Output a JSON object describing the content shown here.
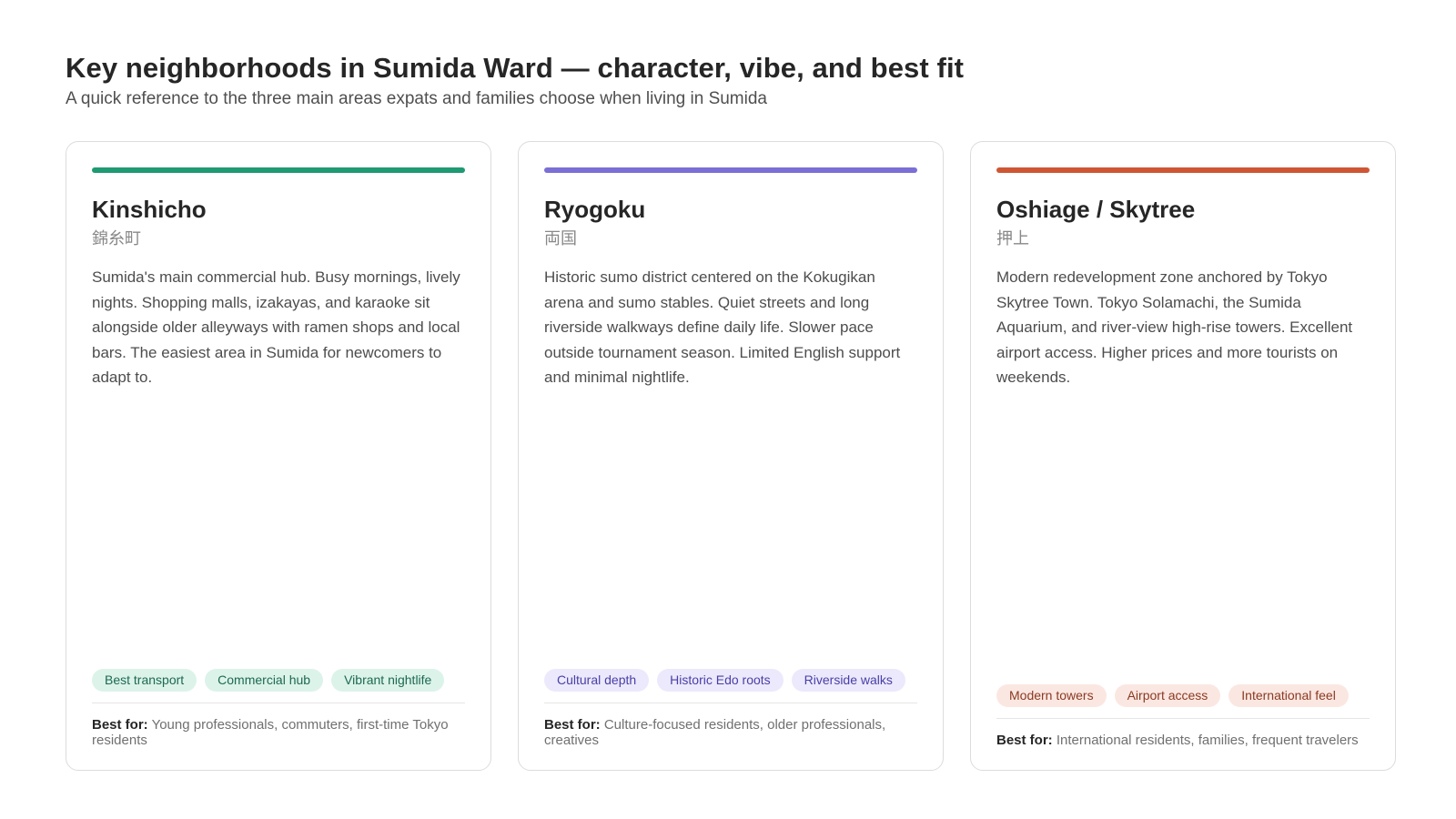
{
  "header": {
    "title": "Key neighborhoods in Sumida Ward — character, vibe, and best fit",
    "subtitle": "A quick reference to the three main areas expats and families choose when living in Sumida"
  },
  "best_for_label": "Best for:",
  "cards": [
    {
      "name": "Kinshicho",
      "japanese": "錦糸町",
      "description": "Sumida's main commercial hub. Busy mornings, lively nights. Shopping malls, izakayas, and karaoke sit alongside older alleyways with ramen shops and local bars. The easiest area in Sumida for newcomers to adapt to.",
      "tags": [
        "Best transport",
        "Commercial hub",
        "Vibrant nightlife"
      ],
      "best_for": "Young professionals, commuters, first-time Tokyo residents",
      "colors": {
        "accent": "#1f9a72",
        "tag_bg": "#dcf3ea",
        "tag_text": "#1d6a50"
      }
    },
    {
      "name": "Ryogoku",
      "japanese": "両国",
      "description": "Historic sumo district centered on the Kokugikan arena and sumo stables. Quiet streets and long riverside walkways define daily life. Slower pace outside tournament season. Limited English support and minimal nightlife.",
      "tags": [
        "Cultural depth",
        "Historic Edo roots",
        "Riverside walks"
      ],
      "best_for": "Culture-focused residents, older professionals, creatives",
      "colors": {
        "accent": "#7b6fd6",
        "tag_bg": "#ebe9fb",
        "tag_text": "#4a3fa8"
      }
    },
    {
      "name": "Oshiage / Skytree",
      "japanese": "押上",
      "description": "Modern redevelopment zone anchored by Tokyo Skytree Town. Tokyo Solamachi, the Sumida Aquarium, and river-view high-rise towers. Excellent airport access. Higher prices and more tourists on weekends.",
      "tags": [
        "Modern towers",
        "Airport access",
        "International feel"
      ],
      "best_for": "International residents, families, frequent travelers",
      "colors": {
        "accent": "#cf5634",
        "tag_bg": "#fbe7e1",
        "tag_text": "#8a3a22"
      }
    }
  ]
}
